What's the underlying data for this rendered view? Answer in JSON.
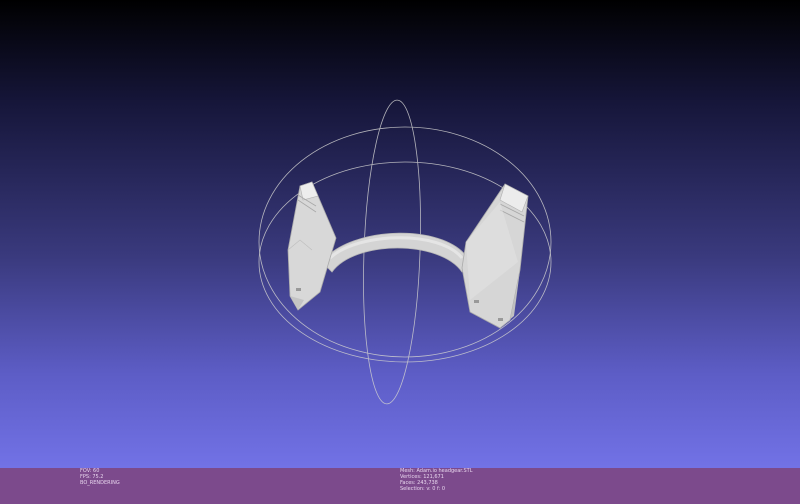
{
  "viewport": {
    "background_top": "#000000",
    "background_bottom": "#7272e6",
    "mesh_color": "#d7d7d7",
    "trackball_color": "#cfcfcf"
  },
  "status_left": {
    "fov": "FOV: 60",
    "fps": "FPS:   75.2",
    "rendering": "BO_RENDERING"
  },
  "status_right": {
    "mesh": "Mesh: Adam.io headgear.STL",
    "vertices": "Vertices: 121,671",
    "faces": "Faces: 243,738",
    "selection": "Selection: v: 0 f: 0"
  },
  "statusbar_color": "#7c4a8c"
}
